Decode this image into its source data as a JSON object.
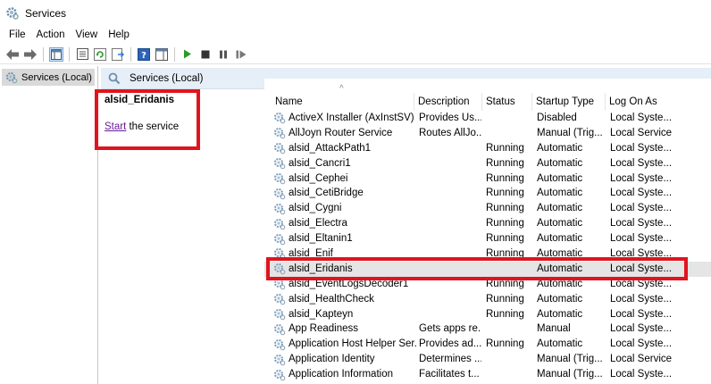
{
  "window": {
    "title": "Services"
  },
  "menu": [
    "File",
    "Action",
    "View",
    "Help"
  ],
  "tree": {
    "label": "Services (Local)"
  },
  "header": {
    "title": "Services (Local)"
  },
  "detail": {
    "service_name": "alsid_Eridanis",
    "start_link": "Start",
    "start_suffix": " the service"
  },
  "columns": {
    "name": "Name",
    "description": "Description",
    "status": "Status",
    "startup": "Startup Type",
    "logon": "Log On As"
  },
  "services": [
    {
      "name": "ActiveX Installer (AxInstSV)",
      "description": "Provides Us...",
      "status": "",
      "startup": "Disabled",
      "logon": "Local Syste..."
    },
    {
      "name": "AllJoyn Router Service",
      "description": "Routes AllJo...",
      "status": "",
      "startup": "Manual (Trig...",
      "logon": "Local Service"
    },
    {
      "name": "alsid_AttackPath1",
      "description": "",
      "status": "Running",
      "startup": "Automatic",
      "logon": "Local Syste..."
    },
    {
      "name": "alsid_Cancri1",
      "description": "",
      "status": "Running",
      "startup": "Automatic",
      "logon": "Local Syste..."
    },
    {
      "name": "alsid_Cephei",
      "description": "",
      "status": "Running",
      "startup": "Automatic",
      "logon": "Local Syste..."
    },
    {
      "name": "alsid_CetiBridge",
      "description": "",
      "status": "Running",
      "startup": "Automatic",
      "logon": "Local Syste..."
    },
    {
      "name": "alsid_Cygni",
      "description": "",
      "status": "Running",
      "startup": "Automatic",
      "logon": "Local Syste..."
    },
    {
      "name": "alsid_Electra",
      "description": "",
      "status": "Running",
      "startup": "Automatic",
      "logon": "Local Syste..."
    },
    {
      "name": "alsid_Eltanin1",
      "description": "",
      "status": "Running",
      "startup": "Automatic",
      "logon": "Local Syste..."
    },
    {
      "name": "alsid_Enif",
      "description": "",
      "status": "Running",
      "startup": "Automatic",
      "logon": "Local Syste..."
    },
    {
      "name": "alsid_Eridanis",
      "description": "",
      "status": "",
      "startup": "Automatic",
      "logon": "Local Syste...",
      "selected": true
    },
    {
      "name": "alsid_EventLogsDecoder1",
      "description": "",
      "status": "Running",
      "startup": "Automatic",
      "logon": "Local Syste..."
    },
    {
      "name": "alsid_HealthCheck",
      "description": "",
      "status": "Running",
      "startup": "Automatic",
      "logon": "Local Syste..."
    },
    {
      "name": "alsid_Kapteyn",
      "description": "",
      "status": "Running",
      "startup": "Automatic",
      "logon": "Local Syste..."
    },
    {
      "name": "App Readiness",
      "description": "Gets apps re...",
      "status": "",
      "startup": "Manual",
      "logon": "Local Syste..."
    },
    {
      "name": "Application Host Helper Ser...",
      "description": "Provides ad...",
      "status": "Running",
      "startup": "Automatic",
      "logon": "Local Syste..."
    },
    {
      "name": "Application Identity",
      "description": "Determines ...",
      "status": "",
      "startup": "Manual (Trig...",
      "logon": "Local Service"
    },
    {
      "name": "Application Information",
      "description": "Facilitates t...",
      "status": "",
      "startup": "Manual (Trig...",
      "logon": "Local Syste..."
    }
  ],
  "colors": {
    "highlight_box": "#e0141e",
    "header_bg": "#e6eef7",
    "selected_row": "#e5e5e5",
    "link": "#6a1b9a"
  }
}
